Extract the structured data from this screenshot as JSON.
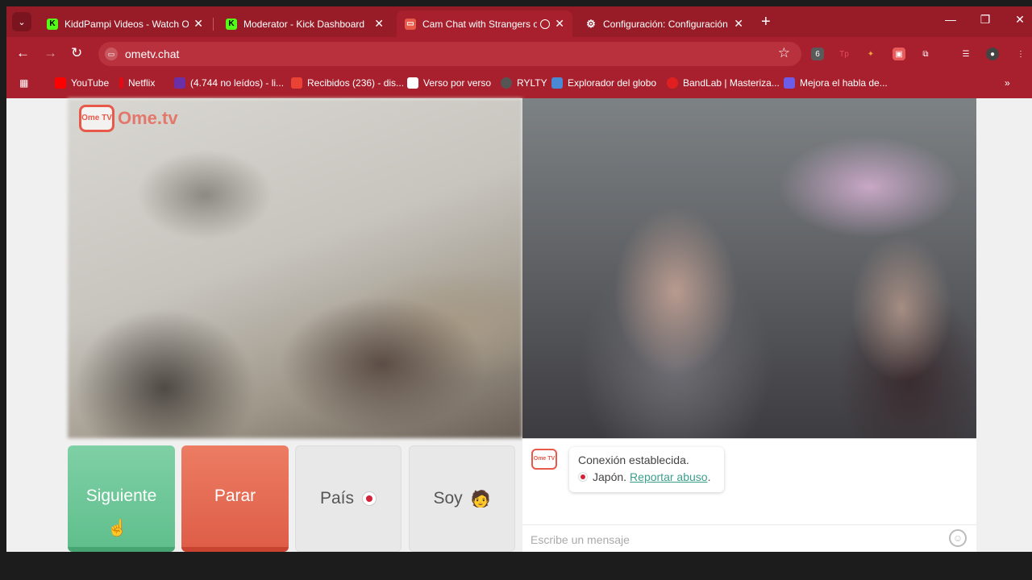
{
  "browser": {
    "tabs": [
      {
        "title": "KiddPampi Videos - Watch On-l",
        "favicon": "kick-icon",
        "active": false
      },
      {
        "title": "Moderator - Kick Dashboard",
        "favicon": "kick-icon",
        "active": false
      },
      {
        "title": "Cam Chat with Strangers on",
        "favicon": "ometv-icon",
        "active": true
      },
      {
        "title": "Configuración: Configuración d",
        "favicon": "gear-icon",
        "active": false
      }
    ],
    "url": "ometv.chat",
    "bookmarks": [
      {
        "label": "YouTube",
        "color": "#ff0000"
      },
      {
        "label": "Netflix",
        "color": "#e50914"
      },
      {
        "label": "(4.744 no leídos) - li...",
        "color": "#6b2fa8"
      },
      {
        "label": "Recibidos (236) - dis...",
        "color": "#ea4335"
      },
      {
        "label": "Verso por verso",
        "color": "#ffffff"
      },
      {
        "label": "RYLTY",
        "color": "#555555"
      },
      {
        "label": "Explorador del globo",
        "color": "#4a8ad4"
      },
      {
        "label": "BandLab | Masteriza...",
        "color": "#e02020"
      },
      {
        "label": "Mejora el habla de...",
        "color": "#6d5ce7"
      }
    ]
  },
  "ometv": {
    "logo_badge": "Ome TV",
    "logo_text": "Ome.tv",
    "buttons": {
      "next": "Siguiente",
      "stop": "Parar",
      "country": "País",
      "gender": "Soy"
    },
    "chat": {
      "status": "Conexión establecida.",
      "country": "Japón.",
      "report": "Reportar abuso",
      "report_suffix": ".",
      "input_placeholder": "Escribe un mensaje"
    }
  }
}
